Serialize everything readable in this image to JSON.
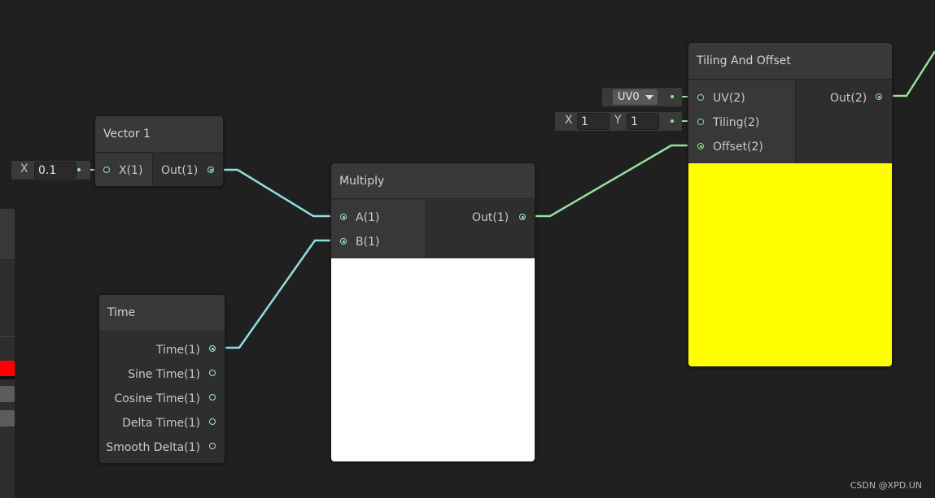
{
  "colors": {
    "wire_float": "#8ee0e2",
    "wire_vector2": "#96e19e",
    "preview_multiply": "#ffffff",
    "preview_tiling": "#ffff00",
    "left_panel_swatch": "#ff0000"
  },
  "nodes": {
    "vector1": {
      "title": "Vector 1",
      "input_label": "X(1)",
      "output_label": "Out(1)",
      "field_label": "X",
      "field_value": "0.1"
    },
    "time": {
      "title": "Time",
      "outputs": [
        "Time(1)",
        "Sine Time(1)",
        "Cosine Time(1)",
        "Delta Time(1)",
        "Smooth Delta(1)"
      ]
    },
    "multiply": {
      "title": "Multiply",
      "input_a": "A(1)",
      "input_b": "B(1)",
      "output_label": "Out(1)"
    },
    "tiling": {
      "title": "Tiling And Offset",
      "input_uv": "UV(2)",
      "input_tiling": "Tiling(2)",
      "input_offset": "Offset(2)",
      "output_label": "Out(2)",
      "uv_dropdown_value": "UV0",
      "tiling_x_label": "X",
      "tiling_x_value": "1",
      "tiling_y_label": "Y",
      "tiling_y_value": "1"
    }
  },
  "watermark": "CSDN @XPD.UN"
}
